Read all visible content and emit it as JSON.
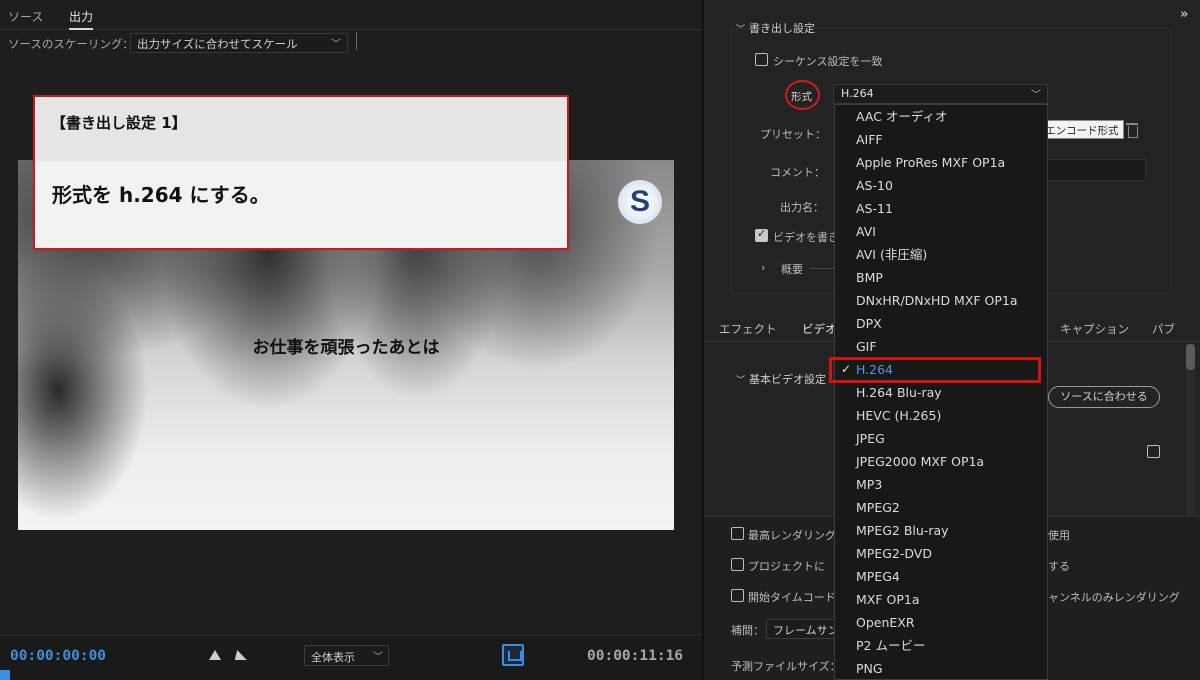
{
  "left_tabs": [
    "ソース",
    "出力"
  ],
  "scaling": {
    "label": "ソースのスケーリング：",
    "value": "出力サイズに合わせてスケール"
  },
  "annotation": {
    "title": "【書き出し設定 1】",
    "text": "形式を h.264 にする。"
  },
  "preview": {
    "caption": "お仕事を頑張ったあとは",
    "logo_letter": "S"
  },
  "timeline": {
    "timecode_current": "00:00:00:00",
    "timecode_duration": "00:00:11:16",
    "zoom_value": "全体表示"
  },
  "export_settings": {
    "title": "書き出し設定",
    "match_sequence": "シーケンス設定を一致",
    "format_label": "形式",
    "format_value": "H.264",
    "preset_label": "プリセット：",
    "comment_label": "コメント：",
    "output_name_label": "出力名：",
    "export_video_label": "ビデオを書き",
    "summary_label": "概要",
    "tooltip": "エンコード形式"
  },
  "fx_tabs": [
    "エフェクト",
    "ビデオ",
    "キャプション",
    "パブ"
  ],
  "video_settings": {
    "basic_label": "基本ビデオ設定",
    "match_source_button": "ソースに合わせる"
  },
  "bottom_options": {
    "max_render": "最高レンダリング",
    "max_render_tail": "使用",
    "project": "プロジェクトに",
    "project_tail": "する",
    "start_timecode": "開始タイムコード",
    "start_timecode_tail": "ャンネルのみレンダリング",
    "interp_label": "補間：",
    "interp_value": "フレームサン",
    "file_size_label": "予測ファイルサイズ："
  },
  "format_options": [
    "AAC オーディオ",
    "AIFF",
    "Apple ProRes MXF OP1a",
    "AS-10",
    "AS-11",
    "AVI",
    "AVI (非圧縮)",
    "BMP",
    "DNxHR/DNxHD MXF OP1a",
    "DPX",
    "GIF",
    "H.264",
    "H.264 Blu-ray",
    "HEVC (H.265)",
    "JPEG",
    "JPEG2000 MXF OP1a",
    "MP3",
    "MPEG2",
    "MPEG2 Blu-ray",
    "MPEG2-DVD",
    "MPEG4",
    "MXF OP1a",
    "OpenEXR",
    "P2 ムービー",
    "PNG"
  ],
  "selected_format_index": 11,
  "colors": {
    "accent": "#3b8fdc",
    "highlight_red": "#d21414"
  }
}
